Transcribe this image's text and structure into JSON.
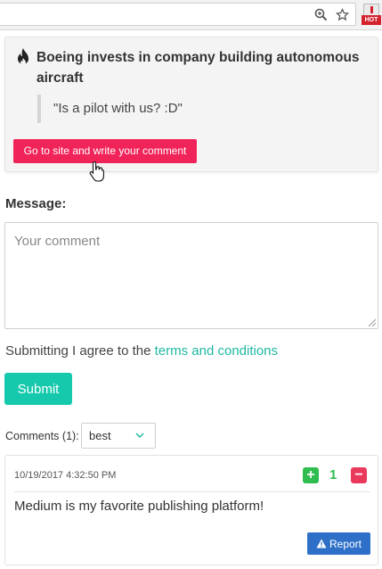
{
  "browser": {
    "zoom_icon": "zoom-in-icon",
    "star_icon": "star-icon",
    "extension_badge": "HOT"
  },
  "popup": {
    "icon": "flame-icon",
    "title": "Boeing invests in company building autonomous aircraft",
    "quote": "\"Is a pilot with us? :D\"",
    "button_label": "Go to site and write your comment",
    "button_color": "#f1245a"
  },
  "form": {
    "message_label": "Message:",
    "comment_placeholder": "Your comment",
    "comment_value": "",
    "terms_prefix": "Submitting I agree to the ",
    "terms_link": "terms and conditions",
    "submit_label": "Submit",
    "accent_color": "#16c9ad"
  },
  "comments": {
    "label": "Comments (1):",
    "sort_selected": "best",
    "items": [
      {
        "date": "10/19/2017 4:32:50 PM",
        "plus": "+",
        "score": "1",
        "minus": "−",
        "text": "Medium is my favorite publishing platform!",
        "report_label": "Report"
      }
    ]
  }
}
